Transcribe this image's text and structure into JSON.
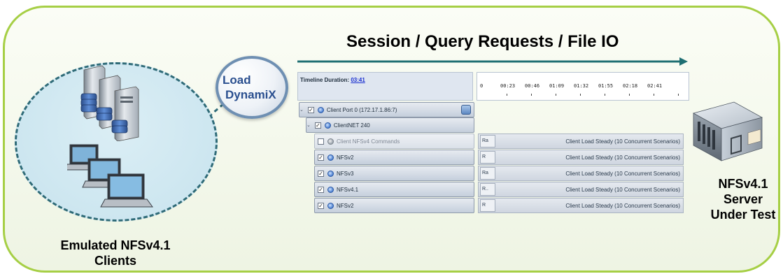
{
  "clients": {
    "label_line1": "Emulated NFSv4.1",
    "label_line2": "Clients"
  },
  "load_dynamix": {
    "line1": "Load",
    "line2": "DynamiX"
  },
  "flow": {
    "title": "Session / Query Requests / File IO"
  },
  "timeline": {
    "duration_label": "Timeline Duration:",
    "duration_value": "03:41",
    "ticks": [
      "0",
      "00:23",
      "00:46",
      "01:09",
      "01:32",
      "01:55",
      "02:18",
      "02:41"
    ]
  },
  "rows": {
    "port": {
      "label": "Client Port 0 (172.17.1.86:7)"
    },
    "clientnet": {
      "label": "ClientNET 240"
    },
    "items": [
      {
        "label": "Client NFSv4 Commands",
        "checked": false,
        "tag": "Ra",
        "desc": "Client Load Steady (10 Concurrent Scenarios)"
      },
      {
        "label": "NFSv2",
        "checked": true,
        "tag": "R",
        "desc": "Client Load Steady (10 Concurrent Scenarios)"
      },
      {
        "label": "NFSv3",
        "checked": true,
        "tag": "Ra",
        "desc": "Client Load Steady (10 Concurrent Scenarios)"
      },
      {
        "label": "NFSv4.1",
        "checked": true,
        "tag": "R..",
        "desc": "Client Load Steady (10 Concurrent Scenarios)"
      },
      {
        "label": "NFSv2",
        "checked": true,
        "tag": "R",
        "desc": "Client Load Steady (10 Concurrent Scenarios)"
      }
    ]
  },
  "server": {
    "line1": "NFSv4.1",
    "line2": "Server",
    "line3": "Under Test"
  },
  "colors": {
    "panel_border": "#a6cf45",
    "circle_dash": "#2f6b78",
    "arrow": "#1f6f73",
    "ld_text": "#2a4f8f"
  }
}
